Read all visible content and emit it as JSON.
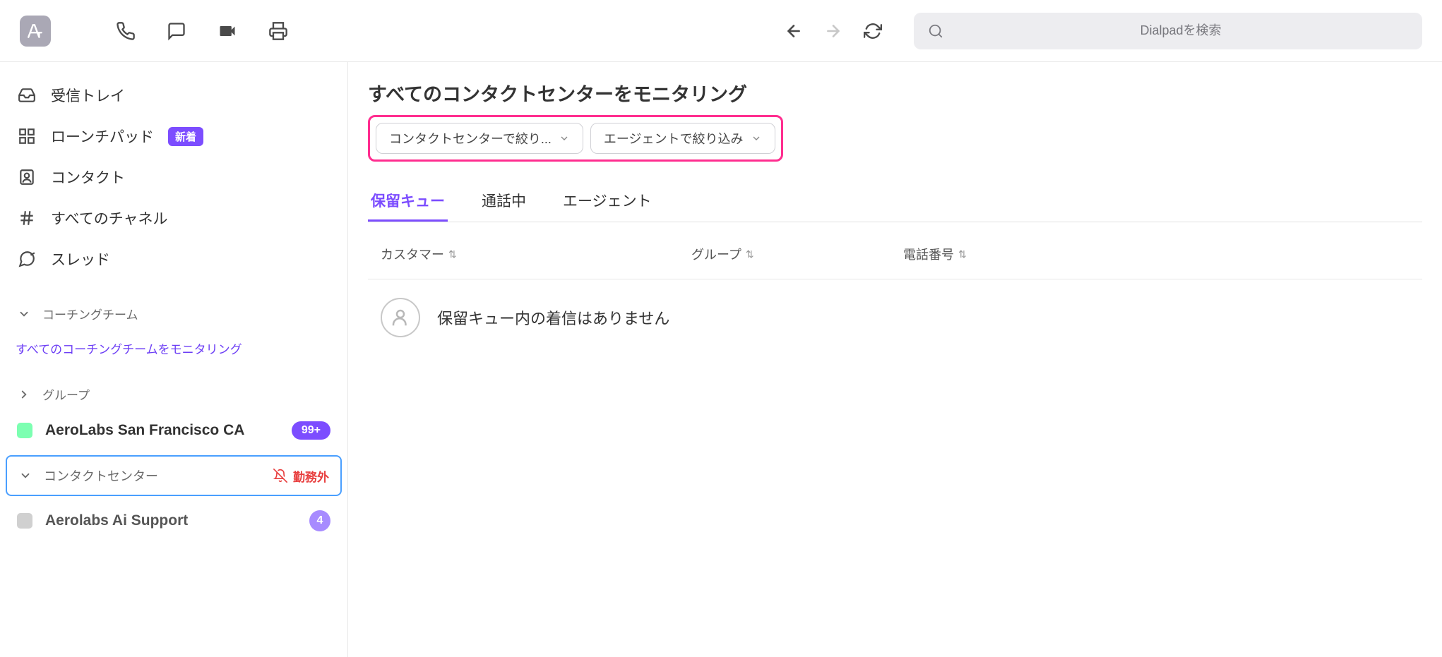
{
  "search": {
    "placeholder": "Dialpadを検索"
  },
  "sidebar": {
    "items": [
      {
        "label": "受信トレイ"
      },
      {
        "label": "ローンチパッド",
        "badge": "新着"
      },
      {
        "label": "コンタクト"
      },
      {
        "label": "すべてのチャネル"
      },
      {
        "label": "スレッド"
      }
    ],
    "coaching": {
      "title": "コーチングチーム",
      "link": "すべてのコーチングチームをモニタリング"
    },
    "groups": {
      "title": "グループ",
      "items": [
        {
          "name": "AeroLabs San Francisco CA",
          "count": "99+"
        }
      ]
    },
    "contactCenter": {
      "title": "コンタクトセンター",
      "status": "勤務外",
      "items": [
        {
          "name": "Aerolabs Ai Support",
          "count": "4"
        }
      ]
    }
  },
  "main": {
    "title": "すべてのコンタクトセンターをモニタリング",
    "filters": [
      "コンタクトセンターで絞り...",
      "エージェントで絞り込み"
    ],
    "tabs": [
      "保留キュー",
      "通話中",
      "エージェント"
    ],
    "columns": [
      "カスタマー",
      "グループ",
      "電話番号"
    ],
    "emptyMessage": "保留キュー内の着信はありません"
  }
}
